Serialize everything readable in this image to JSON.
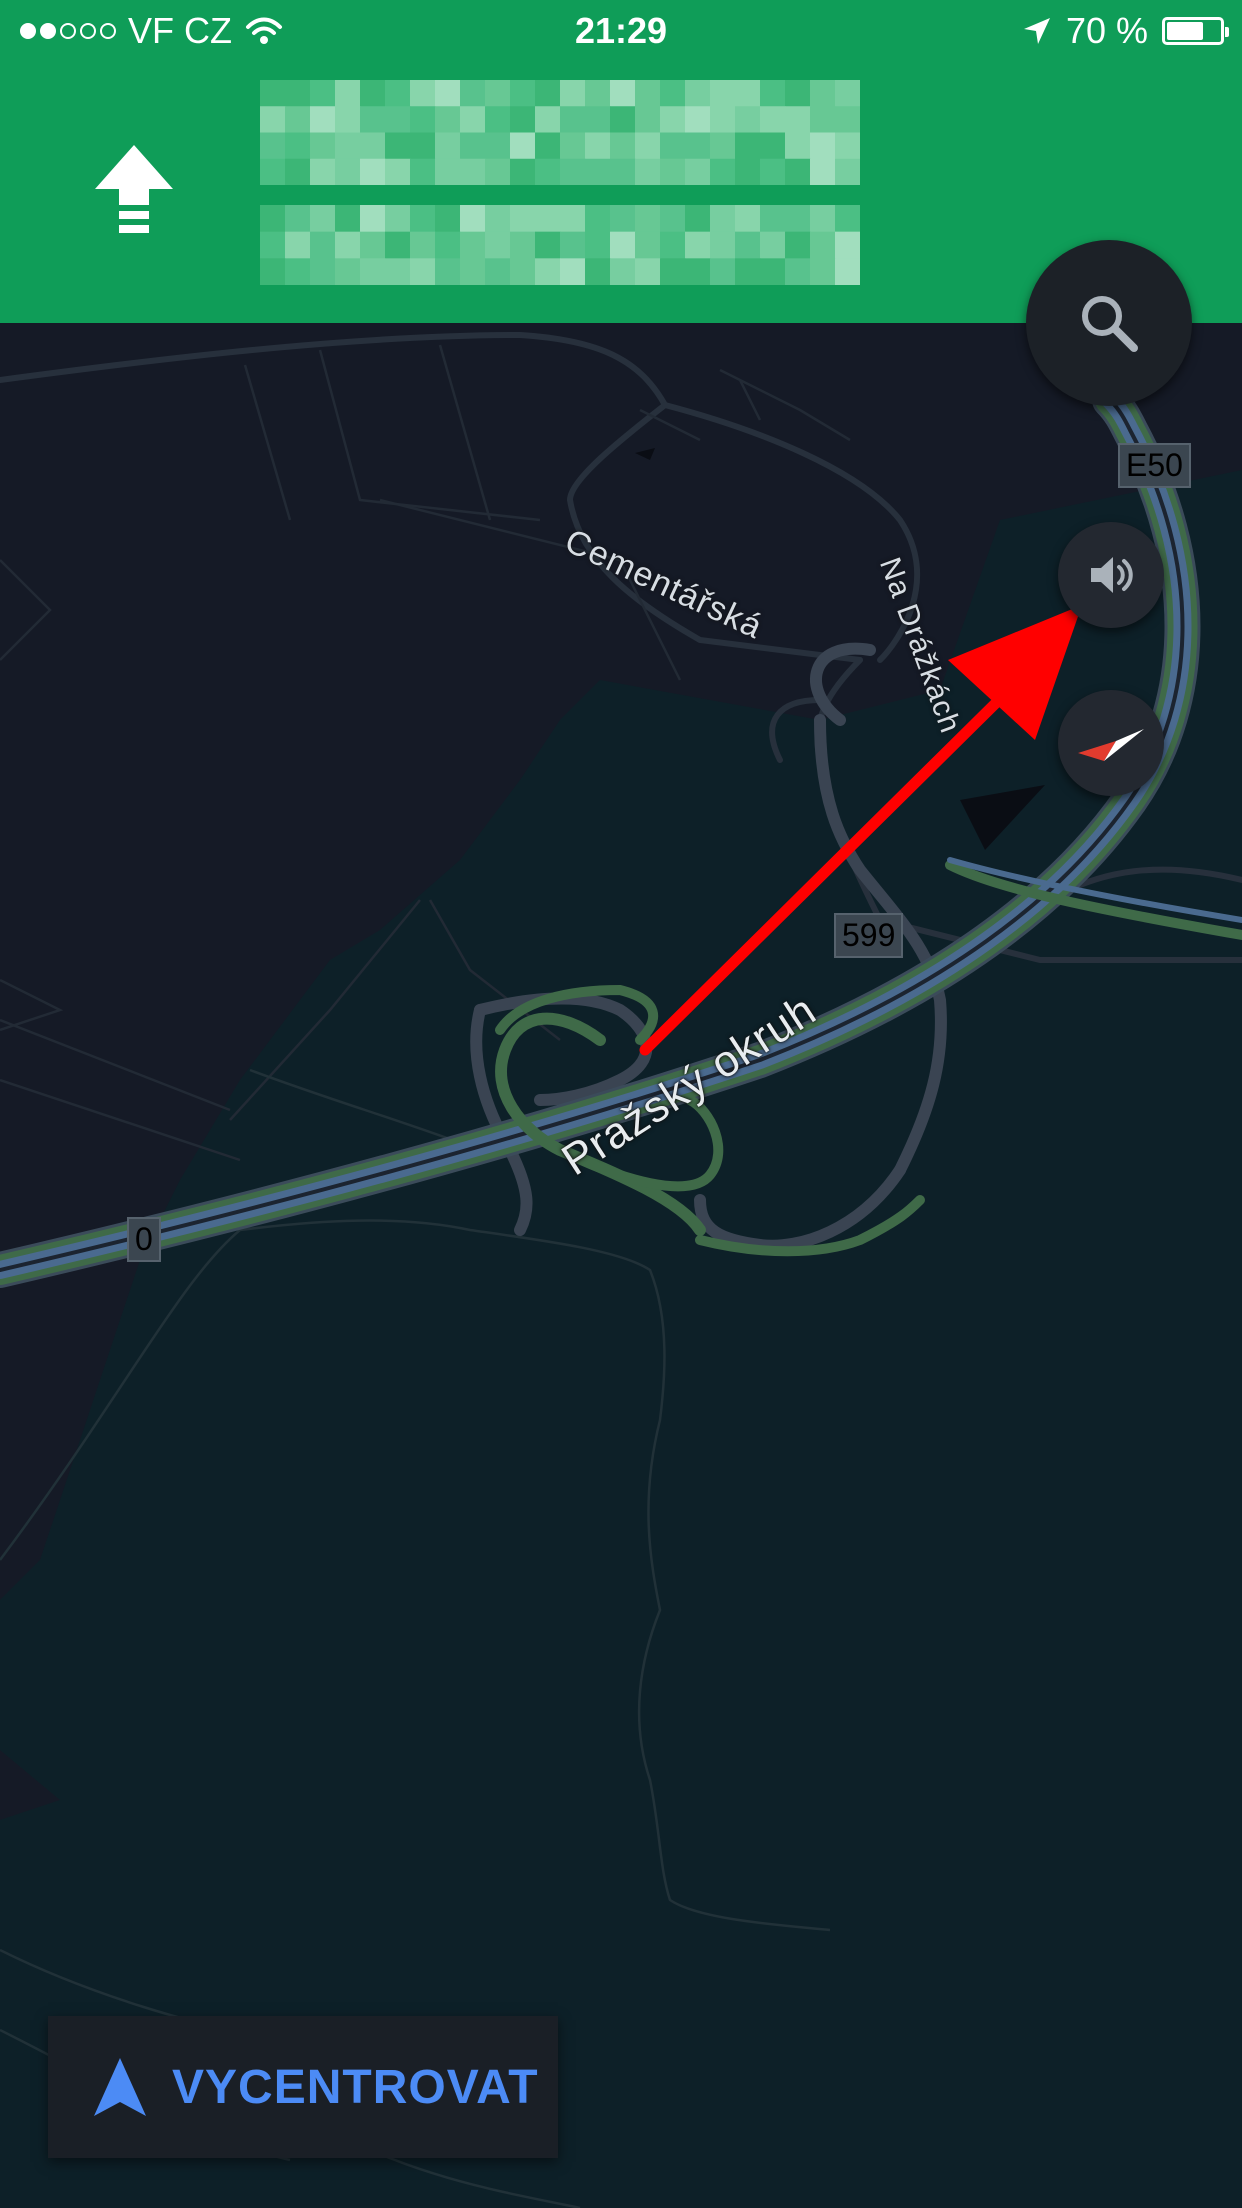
{
  "status_bar": {
    "carrier": "VF CZ",
    "time": "21:29",
    "battery_text": "70 %",
    "battery_level": 0.7,
    "signal_bars": 2,
    "signal_total": 5
  },
  "navigation_header": {
    "maneuver_icon": "straight-arrow-icon",
    "background_color": "#0f9d58"
  },
  "map_labels": {
    "street_cementarska": "Cementářská",
    "street_na_drazkach": "Na Drážkách",
    "road_prazsky_okruh": "Pražský okruh",
    "shield_e50": "E50",
    "shield_599": "599",
    "shield_0": "0"
  },
  "controls": {
    "search_icon": "search-icon",
    "sound_icon": "speaker-icon",
    "compass_icon": "compass-icon",
    "recenter_label": "VYCENTROVAT",
    "recenter_icon": "navigation-arrow-icon",
    "accent_color": "#4c8bf5"
  },
  "annotation": {
    "arrow_color": "#ff0000"
  }
}
